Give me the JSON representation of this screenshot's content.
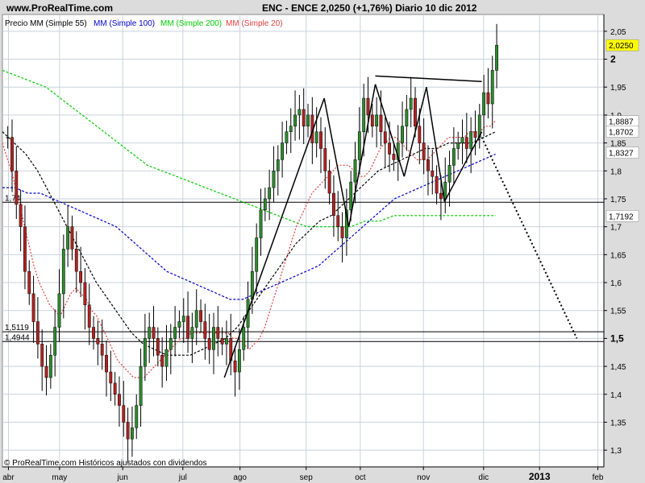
{
  "header": {
    "site": "www.ProRealTime.com",
    "title": "ENC - ENCE    2,0250 (+1,76%)   Diario  10 dic 2012"
  },
  "legend": [
    {
      "text": "Precio MM (Simple 55)",
      "color": "#000000"
    },
    {
      "text": "MM (Simple 100)",
      "color": "#0000cc"
    },
    {
      "text": "MM (Simple 200)",
      "color": "#00cc00"
    },
    {
      "text": "MM (Simple 20)",
      "color": "#e04040"
    }
  ],
  "footer": {
    "copyright": "© ProRealTime.com  Históricos ajustados con dividendos"
  },
  "colors": {
    "up": "#2e8b2e",
    "down": "#b22222",
    "bg": "#ffffff",
    "grid": "#c8d2dc"
  },
  "chart_data": {
    "type": "candlestick",
    "ylim": [
      1.27,
      2.08
    ],
    "xlabels": [
      "abr",
      "may",
      "jun",
      "jul",
      "ago",
      "sep",
      "oct",
      "nov",
      "dic",
      "2013",
      "feb"
    ],
    "yticks": [
      "2,05",
      "2",
      "1,95",
      "1,9",
      "1,85",
      "1,8",
      "1,75",
      "1,7",
      "1,65",
      "1,6",
      "1,55",
      "1,5",
      "1,45",
      "1,4",
      "1,35",
      "1,3"
    ],
    "bold_yticks": [
      "2",
      "1,5"
    ],
    "price_labels": [
      {
        "text": "2,0250",
        "value": 2.025,
        "color": "#000000",
        "bg": "#ffff00"
      },
      {
        "text": "1,8887",
        "value": 1.8887,
        "color": "#e04040",
        "bg": "#ffffff"
      },
      {
        "text": "1,8702",
        "value": 1.8702,
        "color": "#000000",
        "bg": "#ffffff"
      },
      {
        "text": "1,8327",
        "value": 1.8327,
        "color": "#0000cc",
        "bg": "#ffffff"
      },
      {
        "text": "1,7192",
        "value": 1.7192,
        "color": "#00aa00",
        "bg": "#ffffff"
      }
    ],
    "horizontal_levels": [
      {
        "value": 1.7438,
        "label": "1,74"
      },
      {
        "value": 1.5119,
        "label": "1,5119"
      },
      {
        "value": 1.4944,
        "label": "1,4944"
      }
    ],
    "price_path": [
      1.86,
      1.8,
      1.74,
      1.7,
      1.62,
      1.58,
      1.53,
      1.49,
      1.45,
      1.43,
      1.47,
      1.52,
      1.58,
      1.66,
      1.7,
      1.66,
      1.62,
      1.6,
      1.56,
      1.52,
      1.5,
      1.49,
      1.47,
      1.44,
      1.42,
      1.4,
      1.38,
      1.35,
      1.32,
      1.34,
      1.38,
      1.45,
      1.5,
      1.52,
      1.5,
      1.47,
      1.45,
      1.48,
      1.5,
      1.52,
      1.53,
      1.54,
      1.5,
      1.52,
      1.55,
      1.53,
      1.5,
      1.48,
      1.52,
      1.5,
      1.49,
      1.5,
      1.46,
      1.44,
      1.48,
      1.52,
      1.57,
      1.62,
      1.68,
      1.73,
      1.75,
      1.77,
      1.8,
      1.82,
      1.85,
      1.87,
      1.88,
      1.9,
      1.91,
      1.88,
      1.9,
      1.85,
      1.87,
      1.84,
      1.8,
      1.76,
      1.72,
      1.7,
      1.68,
      1.73,
      1.78,
      1.82,
      1.87,
      1.93,
      1.9,
      1.88,
      1.9,
      1.87,
      1.85,
      1.83,
      1.82,
      1.85,
      1.88,
      1.91,
      1.93,
      1.88,
      1.85,
      1.82,
      1.8,
      1.79,
      1.76,
      1.75,
      1.78,
      1.81,
      1.84,
      1.85,
      1.86,
      1.84,
      1.87,
      1.86,
      1.9,
      1.94,
      1.92,
      1.98,
      2.025
    ],
    "ma20": [
      1.85,
      1.82,
      1.79,
      1.75,
      1.71,
      1.67,
      1.63,
      1.6,
      1.58,
      1.56,
      1.55,
      1.54,
      1.56,
      1.58,
      1.59,
      1.58,
      1.57,
      1.55,
      1.54,
      1.52,
      1.5,
      1.48,
      1.46,
      1.45,
      1.44,
      1.43,
      1.43,
      1.43,
      1.44,
      1.45,
      1.46,
      1.47,
      1.48,
      1.49,
      1.5,
      1.5,
      1.51,
      1.51,
      1.51,
      1.51,
      1.51,
      1.51,
      1.51,
      1.51,
      1.5,
      1.5,
      1.49,
      1.48,
      1.49,
      1.5,
      1.52,
      1.55,
      1.58,
      1.61,
      1.64,
      1.67,
      1.7,
      1.72,
      1.74,
      1.76,
      1.77,
      1.78,
      1.79,
      1.8,
      1.81,
      1.81,
      1.81,
      1.8,
      1.79,
      1.79,
      1.8,
      1.82,
      1.84,
      1.85,
      1.86,
      1.86,
      1.85,
      1.84,
      1.83,
      1.82,
      1.82,
      1.82,
      1.83,
      1.84,
      1.85,
      1.86,
      1.86,
      1.86,
      1.86,
      1.87,
      1.87,
      1.87,
      1.88,
      1.88,
      1.89
    ],
    "ma55": [
      1.87,
      1.85,
      1.83,
      1.8,
      1.76,
      1.72,
      1.68,
      1.64,
      1.6,
      1.57,
      1.54,
      1.51,
      1.49,
      1.48,
      1.47,
      1.47,
      1.47,
      1.48,
      1.49,
      1.5,
      1.52,
      1.55,
      1.58,
      1.61,
      1.64,
      1.67,
      1.69,
      1.71,
      1.72,
      1.74,
      1.76,
      1.78,
      1.8,
      1.81,
      1.82,
      1.83,
      1.84,
      1.84,
      1.85,
      1.85,
      1.85,
      1.86,
      1.87
    ],
    "ma100": [
      1.77,
      1.77,
      1.76,
      1.76,
      1.75,
      1.74,
      1.73,
      1.72,
      1.71,
      1.7,
      1.68,
      1.66,
      1.64,
      1.62,
      1.61,
      1.6,
      1.59,
      1.58,
      1.57,
      1.57,
      1.58,
      1.59,
      1.6,
      1.61,
      1.62,
      1.63,
      1.65,
      1.67,
      1.69,
      1.71,
      1.73,
      1.75,
      1.76,
      1.77,
      1.78,
      1.79,
      1.8,
      1.81,
      1.82,
      1.83
    ],
    "ma200": [
      1.98,
      1.97,
      1.96,
      1.95,
      1.93,
      1.91,
      1.89,
      1.87,
      1.85,
      1.83,
      1.81,
      1.8,
      1.79,
      1.78,
      1.77,
      1.76,
      1.75,
      1.74,
      1.73,
      1.72,
      1.71,
      1.7,
      1.7,
      1.7,
      1.7,
      1.71,
      1.71,
      1.72,
      1.72,
      1.72,
      1.72,
      1.72,
      1.72,
      1.72,
      1.72
    ],
    "trendlines": [
      {
        "points": [
          [
            0.369,
            1.43
          ],
          [
            0.535,
            1.93
          ]
        ],
        "style": "solid"
      },
      {
        "points": [
          [
            0.535,
            1.93
          ],
          [
            0.576,
            1.7
          ]
        ],
        "style": "solid"
      },
      {
        "points": [
          [
            0.576,
            1.7
          ],
          [
            0.62,
            1.955
          ]
        ],
        "style": "solid"
      },
      {
        "points": [
          [
            0.62,
            1.955
          ],
          [
            0.668,
            1.79
          ]
        ],
        "style": "solid"
      },
      {
        "points": [
          [
            0.668,
            1.79
          ],
          [
            0.705,
            1.95
          ]
        ],
        "style": "solid"
      },
      {
        "points": [
          [
            0.705,
            1.95
          ],
          [
            0.735,
            1.745
          ]
        ],
        "style": "solid"
      },
      {
        "points": [
          [
            0.735,
            1.745
          ],
          [
            0.797,
            1.87
          ]
        ],
        "style": "solid"
      },
      {
        "points": [
          [
            0.62,
            1.97
          ],
          [
            0.797,
            1.96
          ]
        ],
        "style": "solid"
      },
      {
        "points": [
          [
            0.797,
            1.86
          ],
          [
            0.955,
            1.5
          ]
        ],
        "style": "dotted"
      }
    ]
  }
}
